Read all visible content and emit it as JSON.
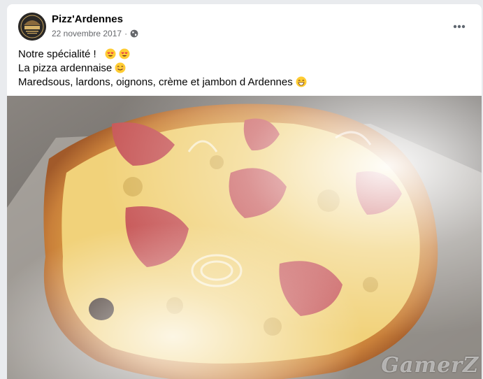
{
  "post": {
    "author": "Pizz'Ardennes",
    "date": "22 novembre 2017",
    "separator": "·",
    "privacy_icon": "globe-icon",
    "more_icon": "more-options-icon",
    "lines": [
      "Notre spécialité !",
      "La pizza ardennaise",
      "Maredsous, lardons, oignons, crème et jambon d Ardennes"
    ],
    "emojis": [
      "heart-eyes-emoji",
      "heart-eyes-emoji",
      "smiling-emoji",
      "grinning-emoji"
    ]
  },
  "photo": {
    "subject": "pizza-photo",
    "watermark": "GamerZ"
  },
  "colors": {
    "text_primary": "#050505",
    "text_secondary": "#65676b",
    "background": "#e9ebee"
  }
}
